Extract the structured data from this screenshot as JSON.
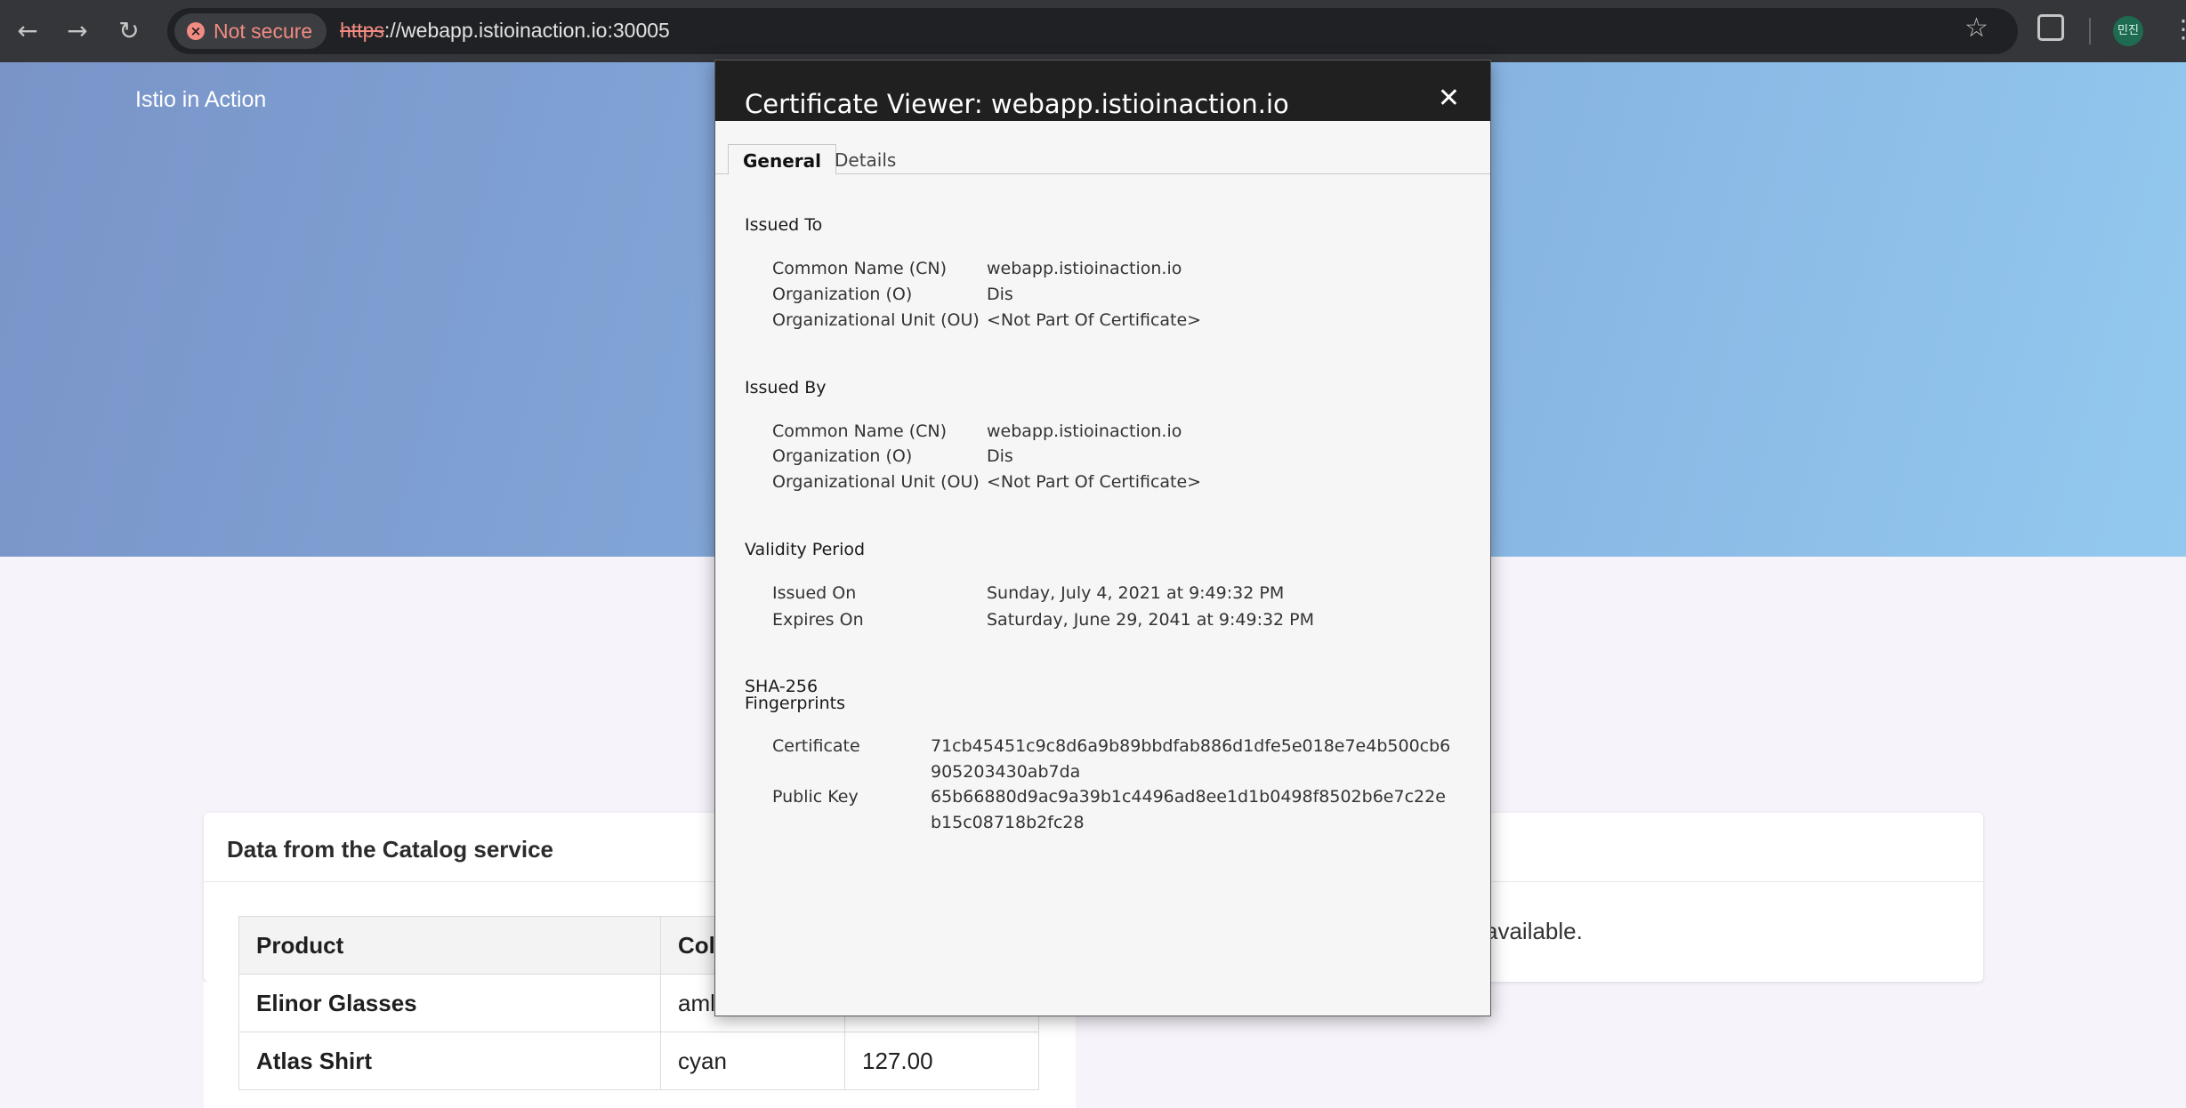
{
  "browser": {
    "security_chip": "Not secure",
    "url_scheme": "https",
    "url_rest": "://webapp.istioinaction.io:30005",
    "profile_label": "민진"
  },
  "page": {
    "brand": "Istio in Action",
    "catalog_title": "Data from the Catalog service",
    "catalog_headers": [
      "Product",
      "Col"
    ],
    "catalog_rows": [
      {
        "product": "Elinor Glasses",
        "color": "aml",
        "price": ""
      },
      {
        "product": "Atlas Shirt",
        "color": "cyan",
        "price": "127.00"
      }
    ],
    "second_card_note": "available."
  },
  "dialog": {
    "title": "Certificate Viewer: webapp.istioinaction.io",
    "tabs": [
      "General",
      "Details"
    ],
    "issued_to": {
      "heading": "Issued To",
      "rows": [
        {
          "label": "Common Name (CN)",
          "value": "webapp.istioinaction.io"
        },
        {
          "label": "Organization (O)",
          "value": "Dis"
        },
        {
          "label": "Organizational Unit (OU)",
          "value": "<Not Part Of Certificate>"
        }
      ]
    },
    "issued_by": {
      "heading": "Issued By",
      "rows": [
        {
          "label": "Common Name (CN)",
          "value": "webapp.istioinaction.io"
        },
        {
          "label": "Organization (O)",
          "value": "Dis"
        },
        {
          "label": "Organizational Unit (OU)",
          "value": "<Not Part Of Certificate>"
        }
      ]
    },
    "validity": {
      "heading": "Validity Period",
      "rows": [
        {
          "label": "Issued On",
          "value": "Sunday, July 4, 2021 at 9:49:32 PM"
        },
        {
          "label": "Expires On",
          "value": "Saturday, June 29, 2041 at 9:49:32 PM"
        }
      ]
    },
    "fingerprints": {
      "heading_line1": "SHA-256",
      "heading_line2": "Fingerprints",
      "rows": [
        {
          "label": "Certificate",
          "value": "71cb45451c9c8d6a9b89bbdfab886d1dfe5e018e7e4b500cb6905203430ab7da"
        },
        {
          "label": "Public Key",
          "value": "65b66880d9ac9a39b1c4496ad8ee1d1b0498f8502b6e7c22eb15c08718b2fc28"
        }
      ]
    }
  }
}
